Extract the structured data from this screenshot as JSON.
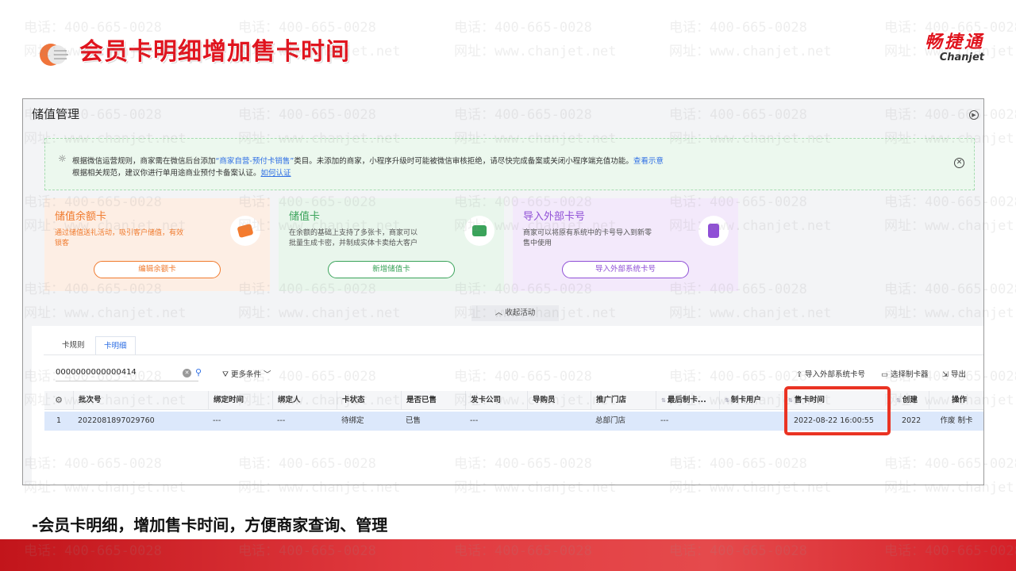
{
  "slide": {
    "title": "会员卡明细增加售卡时间",
    "brand_cn": "畅捷通",
    "brand_en": "Chanjet",
    "caption": "-会员卡明细，增加售卡时间，方便商家查询、管理",
    "accent_color": "#e0141e"
  },
  "watermark": {
    "phone": "电话：400-665-0028",
    "site": "网址：www.chanjet.net"
  },
  "app": {
    "title": "储值管理",
    "notice": {
      "line1_a": "根据微信运营规则，商家需在微信后台添加",
      "line1_highlight": "“商家自营-预付卡销售”",
      "line1_b": "类目。未添加的商家，小程序升级时可能被微信审核拒绝，请尽快完成备案或关闭小程序端充值功能。",
      "line1_link": "查看示意",
      "line2_a": "根据相关规范，建议你进行单用途商业预付卡备案认证。",
      "line2_link": "如何认证"
    },
    "cards": [
      {
        "title": "储值余额卡",
        "desc": "通过储值送礼活动，吸引客户储值，有效锁客",
        "button": "编辑余额卡"
      },
      {
        "title": "储值卡",
        "desc": "在余额的基础上支持了多张卡，商家可以批量生成卡密，并制成实体卡卖给大客户",
        "button": "新增储值卡"
      },
      {
        "title": "导入外部卡号",
        "desc": "商家可以将原有系统中的卡号导入到新零售中使用",
        "button": "导入外部系统卡号"
      }
    ],
    "collapse_label": "收起活动",
    "tabs": [
      {
        "label": "卡规则",
        "active": false
      },
      {
        "label": "卡明细",
        "active": true
      }
    ],
    "search": {
      "value": "0000000000000414"
    },
    "more_filter": "更多条件",
    "toolbar": {
      "import": "导入外部系统卡号",
      "select_maker": "选择制卡器",
      "export": "导出"
    },
    "table": {
      "columns": [
        "批次号",
        "绑定时间",
        "绑定人",
        "卡状态",
        "是否已售",
        "发卡公司",
        "导购员",
        "推广门店",
        "最后制卡...",
        "制卡用户",
        "售卡时间",
        "创建",
        "操作"
      ],
      "rows": [
        {
          "index": "1",
          "batch": "2022081897029760",
          "bind_time": "---",
          "bind_user": "---",
          "status": "待绑定",
          "sold": "已售",
          "issuer": "---",
          "guide": "",
          "store": "总部门店",
          "last_make": "---",
          "maker": "",
          "sale_time": "2022-08-22 16:00:55",
          "created": "2022",
          "ops": "作废 制卡"
        }
      ]
    }
  }
}
